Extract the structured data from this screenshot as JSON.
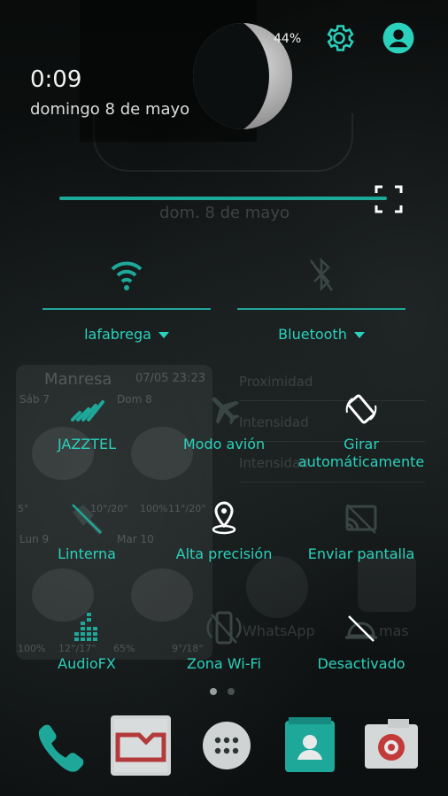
{
  "status": {
    "time": "0:09",
    "date": "domingo 8 de mayo",
    "battery": "44%"
  },
  "background": {
    "lock_date": "dom. 8 de mayo",
    "weather": {
      "city": "Manresa",
      "stamp": "07/05 23:23",
      "days": [
        "Sáb 7",
        "Dom 8",
        "Lun 9",
        "Mar 10"
      ],
      "temps": [
        "5°",
        "10°/20°",
        "100%",
        "11°/20°",
        "12°/17°",
        "65%",
        "9°/18°",
        "100%"
      ]
    },
    "right_list": [
      "Proximidad",
      "Intensidad",
      "Intensidad"
    ],
    "apps": [
      "WhatsApp",
      "mas"
    ]
  },
  "quick_settings": {
    "wifi_label": "lafabrega",
    "bluetooth_label": "Bluetooth",
    "tiles": [
      {
        "label": "JAZZTEL",
        "icon": "signal-bars-icon"
      },
      {
        "label": "Modo avión",
        "icon": "airplane-icon"
      },
      {
        "label": "Girar automáticamente",
        "icon": "rotate-icon"
      },
      {
        "label": "Linterna",
        "icon": "flashlight-icon"
      },
      {
        "label": "Alta precisión",
        "icon": "location-icon"
      },
      {
        "label": "Enviar pantalla",
        "icon": "cast-icon"
      },
      {
        "label": "AudioFX",
        "icon": "equalizer-icon"
      },
      {
        "label": "Zona Wi-Fi",
        "icon": "hotspot-icon"
      },
      {
        "label": "Desactivado",
        "icon": "night-mode-icon"
      }
    ]
  },
  "colors": {
    "accent": "#2ad2bd",
    "accent_dark": "#1ea89a"
  }
}
